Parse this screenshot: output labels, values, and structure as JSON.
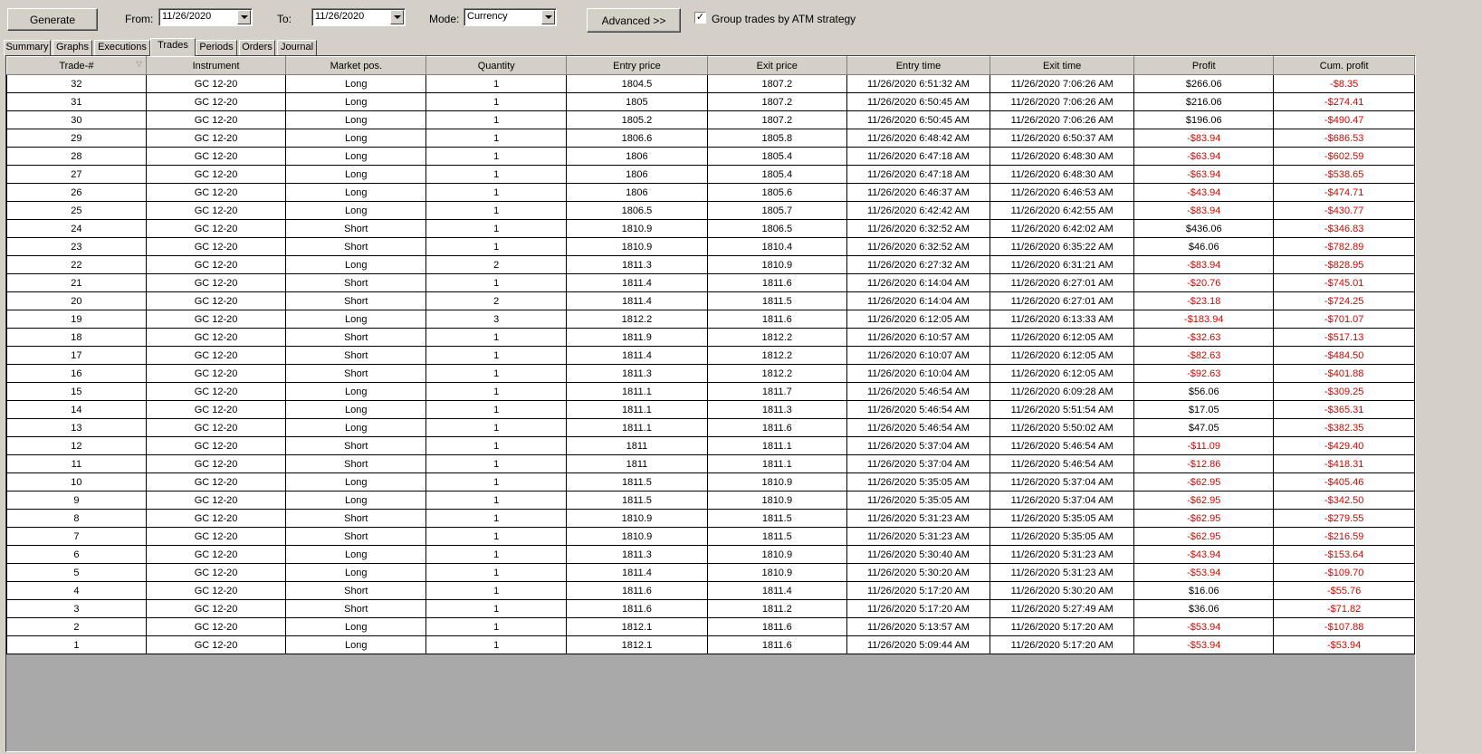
{
  "toolbar": {
    "generate_label": "Generate",
    "from_label": "From:",
    "from_value": "11/26/2020",
    "to_label": "To:",
    "to_value": "11/26/2020",
    "mode_label": "Mode:",
    "mode_value": "Currency",
    "advanced_label": "Advanced >>",
    "group_checked": true,
    "group_label": "Group trades by ATM strategy"
  },
  "tabs": [
    {
      "label": "Summary",
      "active": false
    },
    {
      "label": "Graphs",
      "active": false
    },
    {
      "label": "Executions",
      "active": false
    },
    {
      "label": "Trades",
      "active": true
    },
    {
      "label": "Periods",
      "active": false
    },
    {
      "label": "Orders",
      "active": false
    },
    {
      "label": "Journal",
      "active": false
    }
  ],
  "table": {
    "columns": [
      "Trade-#",
      "Instrument",
      "Market pos.",
      "Quantity",
      "Entry price",
      "Exit price",
      "Entry time",
      "Exit time",
      "Profit",
      "Cum. profit"
    ],
    "sort_indicator": "▽",
    "negative_color": "#e00000",
    "rows": [
      [
        "32",
        "GC 12-20",
        "Long",
        "1",
        "1804.5",
        "1807.2",
        "11/26/2020 6:51:32 AM",
        "11/26/2020 7:06:26 AM",
        "$266.06",
        "-$8.35"
      ],
      [
        "31",
        "GC 12-20",
        "Long",
        "1",
        "1805",
        "1807.2",
        "11/26/2020 6:50:45 AM",
        "11/26/2020 7:06:26 AM",
        "$216.06",
        "-$274.41"
      ],
      [
        "30",
        "GC 12-20",
        "Long",
        "1",
        "1805.2",
        "1807.2",
        "11/26/2020 6:50:45 AM",
        "11/26/2020 7:06:26 AM",
        "$196.06",
        "-$490.47"
      ],
      [
        "29",
        "GC 12-20",
        "Long",
        "1",
        "1806.6",
        "1805.8",
        "11/26/2020 6:48:42 AM",
        "11/26/2020 6:50:37 AM",
        "-$83.94",
        "-$686.53"
      ],
      [
        "28",
        "GC 12-20",
        "Long",
        "1",
        "1806",
        "1805.4",
        "11/26/2020 6:47:18 AM",
        "11/26/2020 6:48:30 AM",
        "-$63.94",
        "-$602.59"
      ],
      [
        "27",
        "GC 12-20",
        "Long",
        "1",
        "1806",
        "1805.4",
        "11/26/2020 6:47:18 AM",
        "11/26/2020 6:48:30 AM",
        "-$63.94",
        "-$538.65"
      ],
      [
        "26",
        "GC 12-20",
        "Long",
        "1",
        "1806",
        "1805.6",
        "11/26/2020 6:46:37 AM",
        "11/26/2020 6:46:53 AM",
        "-$43.94",
        "-$474.71"
      ],
      [
        "25",
        "GC 12-20",
        "Long",
        "1",
        "1806.5",
        "1805.7",
        "11/26/2020 6:42:42 AM",
        "11/26/2020 6:42:55 AM",
        "-$83.94",
        "-$430.77"
      ],
      [
        "24",
        "GC 12-20",
        "Short",
        "1",
        "1810.9",
        "1806.5",
        "11/26/2020 6:32:52 AM",
        "11/26/2020 6:42:02 AM",
        "$436.06",
        "-$346.83"
      ],
      [
        "23",
        "GC 12-20",
        "Short",
        "1",
        "1810.9",
        "1810.4",
        "11/26/2020 6:32:52 AM",
        "11/26/2020 6:35:22 AM",
        "$46.06",
        "-$782.89"
      ],
      [
        "22",
        "GC 12-20",
        "Long",
        "2",
        "1811.3",
        "1810.9",
        "11/26/2020 6:27:32 AM",
        "11/26/2020 6:31:21 AM",
        "-$83.94",
        "-$828.95"
      ],
      [
        "21",
        "GC 12-20",
        "Short",
        "1",
        "1811.4",
        "1811.6",
        "11/26/2020 6:14:04 AM",
        "11/26/2020 6:27:01 AM",
        "-$20.76",
        "-$745.01"
      ],
      [
        "20",
        "GC 12-20",
        "Short",
        "2",
        "1811.4",
        "1811.5",
        "11/26/2020 6:14:04 AM",
        "11/26/2020 6:27:01 AM",
        "-$23.18",
        "-$724.25"
      ],
      [
        "19",
        "GC 12-20",
        "Long",
        "3",
        "1812.2",
        "1811.6",
        "11/26/2020 6:12:05 AM",
        "11/26/2020 6:13:33 AM",
        "-$183.94",
        "-$701.07"
      ],
      [
        "18",
        "GC 12-20",
        "Short",
        "1",
        "1811.9",
        "1812.2",
        "11/26/2020 6:10:57 AM",
        "11/26/2020 6:12:05 AM",
        "-$32.63",
        "-$517.13"
      ],
      [
        "17",
        "GC 12-20",
        "Short",
        "1",
        "1811.4",
        "1812.2",
        "11/26/2020 6:10:07 AM",
        "11/26/2020 6:12:05 AM",
        "-$82.63",
        "-$484.50"
      ],
      [
        "16",
        "GC 12-20",
        "Short",
        "1",
        "1811.3",
        "1812.2",
        "11/26/2020 6:10:04 AM",
        "11/26/2020 6:12:05 AM",
        "-$92.63",
        "-$401.88"
      ],
      [
        "15",
        "GC 12-20",
        "Long",
        "1",
        "1811.1",
        "1811.7",
        "11/26/2020 5:46:54 AM",
        "11/26/2020 6:09:28 AM",
        "$56.06",
        "-$309.25"
      ],
      [
        "14",
        "GC 12-20",
        "Long",
        "1",
        "1811.1",
        "1811.3",
        "11/26/2020 5:46:54 AM",
        "11/26/2020 5:51:54 AM",
        "$17.05",
        "-$365.31"
      ],
      [
        "13",
        "GC 12-20",
        "Long",
        "1",
        "1811.1",
        "1811.6",
        "11/26/2020 5:46:54 AM",
        "11/26/2020 5:50:02 AM",
        "$47.05",
        "-$382.35"
      ],
      [
        "12",
        "GC 12-20",
        "Short",
        "1",
        "1811",
        "1811.1",
        "11/26/2020 5:37:04 AM",
        "11/26/2020 5:46:54 AM",
        "-$11.09",
        "-$429.40"
      ],
      [
        "11",
        "GC 12-20",
        "Short",
        "1",
        "1811",
        "1811.1",
        "11/26/2020 5:37:04 AM",
        "11/26/2020 5:46:54 AM",
        "-$12.86",
        "-$418.31"
      ],
      [
        "10",
        "GC 12-20",
        "Long",
        "1",
        "1811.5",
        "1810.9",
        "11/26/2020 5:35:05 AM",
        "11/26/2020 5:37:04 AM",
        "-$62.95",
        "-$405.46"
      ],
      [
        "9",
        "GC 12-20",
        "Long",
        "1",
        "1811.5",
        "1810.9",
        "11/26/2020 5:35:05 AM",
        "11/26/2020 5:37:04 AM",
        "-$62.95",
        "-$342.50"
      ],
      [
        "8",
        "GC 12-20",
        "Short",
        "1",
        "1810.9",
        "1811.5",
        "11/26/2020 5:31:23 AM",
        "11/26/2020 5:35:05 AM",
        "-$62.95",
        "-$279.55"
      ],
      [
        "7",
        "GC 12-20",
        "Short",
        "1",
        "1810.9",
        "1811.5",
        "11/26/2020 5:31:23 AM",
        "11/26/2020 5:35:05 AM",
        "-$62.95",
        "-$216.59"
      ],
      [
        "6",
        "GC 12-20",
        "Long",
        "1",
        "1811.3",
        "1810.9",
        "11/26/2020 5:30:40 AM",
        "11/26/2020 5:31:23 AM",
        "-$43.94",
        "-$153.64"
      ],
      [
        "5",
        "GC 12-20",
        "Long",
        "1",
        "1811.4",
        "1810.9",
        "11/26/2020 5:30:20 AM",
        "11/26/2020 5:31:23 AM",
        "-$53.94",
        "-$109.70"
      ],
      [
        "4",
        "GC 12-20",
        "Short",
        "1",
        "1811.6",
        "1811.4",
        "11/26/2020 5:17:20 AM",
        "11/26/2020 5:30:20 AM",
        "$16.06",
        "-$55.76"
      ],
      [
        "3",
        "GC 12-20",
        "Short",
        "1",
        "1811.6",
        "1811.2",
        "11/26/2020 5:17:20 AM",
        "11/26/2020 5:27:49 AM",
        "$36.06",
        "-$71.82"
      ],
      [
        "2",
        "GC 12-20",
        "Long",
        "1",
        "1812.1",
        "1811.6",
        "11/26/2020 5:13:57 AM",
        "11/26/2020 5:17:20 AM",
        "-$53.94",
        "-$107.88"
      ],
      [
        "1",
        "GC 12-20",
        "Long",
        "1",
        "1812.1",
        "1811.6",
        "11/26/2020 5:09:44 AM",
        "11/26/2020 5:17:20 AM",
        "-$53.94",
        "-$53.94"
      ]
    ]
  }
}
